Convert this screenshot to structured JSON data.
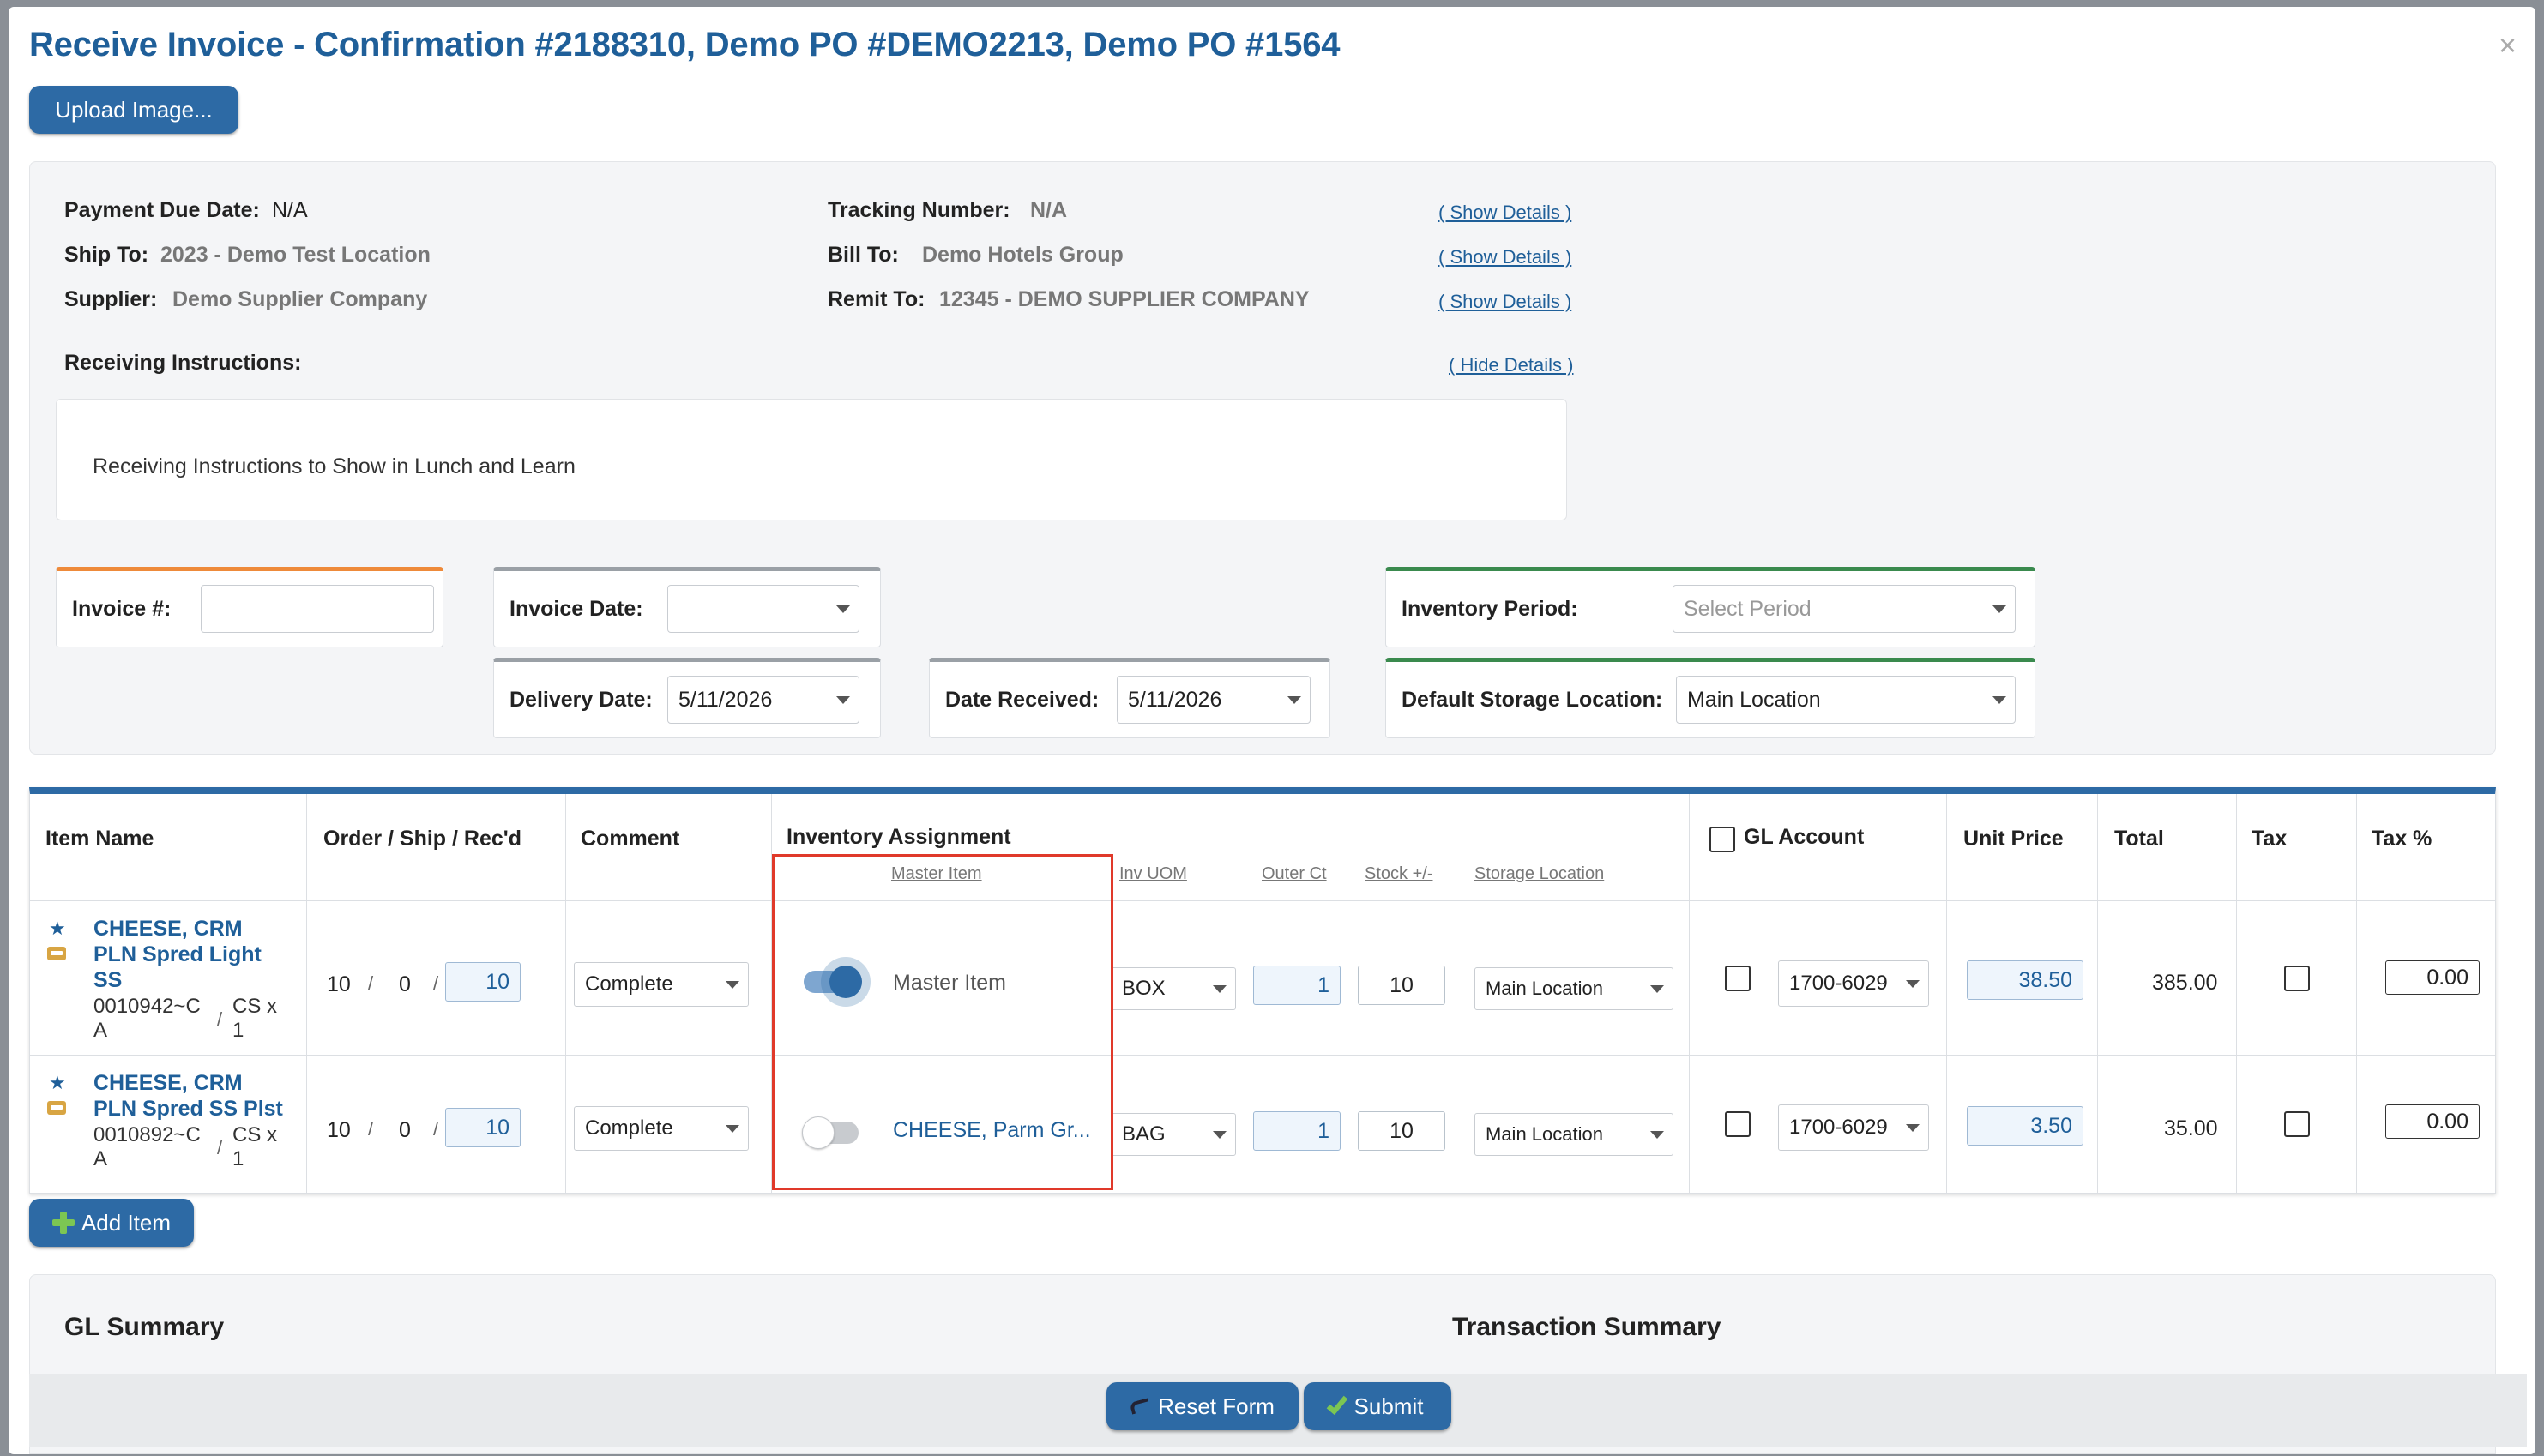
{
  "dialog": {
    "title": "Receive Invoice - Confirmation #2188310, Demo PO #DEMO2213, Demo PO #1564",
    "close_icon": "×",
    "upload_label": "Upload Image..."
  },
  "info": {
    "payment_due_label": "Payment Due Date:",
    "payment_due_value": "N/A",
    "ship_to_label": "Ship To:",
    "ship_to_value": "2023 - Demo Test Location",
    "supplier_label": "Supplier:",
    "supplier_value": "Demo Supplier Company",
    "tracking_label": "Tracking Number:",
    "tracking_value": "N/A",
    "bill_to_label": "Bill To:",
    "bill_to_value": "Demo Hotels Group",
    "remit_to_label": "Remit To:",
    "remit_to_value": "12345 - DEMO SUPPLIER COMPANY",
    "show_details": "( Show Details )",
    "receiving_label": "Receiving Instructions:",
    "hide_details": "( Hide Details )",
    "receiving_text": "Receiving Instructions to Show in Lunch and Learn"
  },
  "form": {
    "invoice_no_label": "Invoice #:",
    "invoice_no_value": "",
    "invoice_date_label": "Invoice Date:",
    "invoice_date_value": "",
    "delivery_date_label": "Delivery Date:",
    "delivery_date_value": "5/11/2026",
    "date_received_label": "Date Received:",
    "date_received_value": "5/11/2026",
    "inventory_period_label": "Inventory Period:",
    "inventory_period_placeholder": "Select Period",
    "storage_label": "Default Storage Location:",
    "storage_value": "Main Location"
  },
  "table": {
    "headers": {
      "item_name": "Item Name",
      "order_ship": "Order / Ship / Rec'd",
      "comment": "Comment",
      "inventory": "Inventory Assignment",
      "gl_account": "GL Account",
      "unit_price": "Unit Price",
      "total": "Total",
      "tax": "Tax",
      "tax_pct": "Tax %"
    },
    "subheaders": {
      "master_item": "Master Item",
      "inv_uom": "Inv UOM",
      "outer_ct": "Outer Ct",
      "stock": "Stock +/-",
      "storage_location": "Storage Location"
    },
    "rows": [
      {
        "name_line1": "CHEESE, CRM",
        "name_line2": "PLN Spred Light",
        "name_line3": "SS",
        "code_line1": "0010942~C",
        "code_line2": "A",
        "unit_line1": "CS x",
        "unit_line2": "1",
        "sep": "/",
        "order": "10",
        "ship": "0",
        "recd": "10",
        "comment": "Complete",
        "master_on": true,
        "master_label": "Master Item",
        "uom": "BOX",
        "outer_ct": "1",
        "stock": "10",
        "storage": "Main Location",
        "gl": "1700-6029",
        "unit_price": "38.50",
        "total": "385.00",
        "tax_pct": "0.00"
      },
      {
        "name_line1": "CHEESE, CRM",
        "name_line2": "PLN Spred SS Plst",
        "name_line3": "",
        "code_line1": "0010892~C",
        "code_line2": "A",
        "unit_line1": "CS x",
        "unit_line2": "1",
        "sep": "/",
        "order": "10",
        "ship": "0",
        "recd": "10",
        "comment": "Complete",
        "master_on": false,
        "master_label": "CHEESE, Parm Gr...",
        "uom": "BAG",
        "outer_ct": "1",
        "stock": "10",
        "storage": "Main Location",
        "gl": "1700-6029",
        "unit_price": "3.50",
        "total": "35.00",
        "tax_pct": "0.00"
      }
    ]
  },
  "actions": {
    "add_item": "Add Item",
    "reset": "Reset Form",
    "submit": "Submit"
  },
  "summary": {
    "gl_title": "GL Summary",
    "transaction_title": "Transaction Summary"
  },
  "colors": {
    "accent": "#2d6aa5",
    "title": "#1f5f99",
    "highlight": "#e0392a"
  }
}
